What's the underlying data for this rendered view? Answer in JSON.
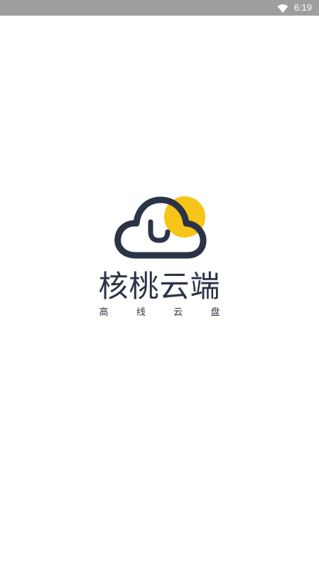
{
  "status_bar": {
    "time": "6:19",
    "icons": [
      "wifi-icon"
    ],
    "background": "#9e9e9e"
  },
  "splash": {
    "logo_icon": "cloud-sun-logo-icon",
    "app_name": "核桃云端",
    "slogan": [
      "高",
      "线",
      "云",
      "盘"
    ]
  },
  "colors": {
    "brand_dark": "#2b3346",
    "brand_yellow": "#f5c518",
    "background": "#ffffff"
  }
}
